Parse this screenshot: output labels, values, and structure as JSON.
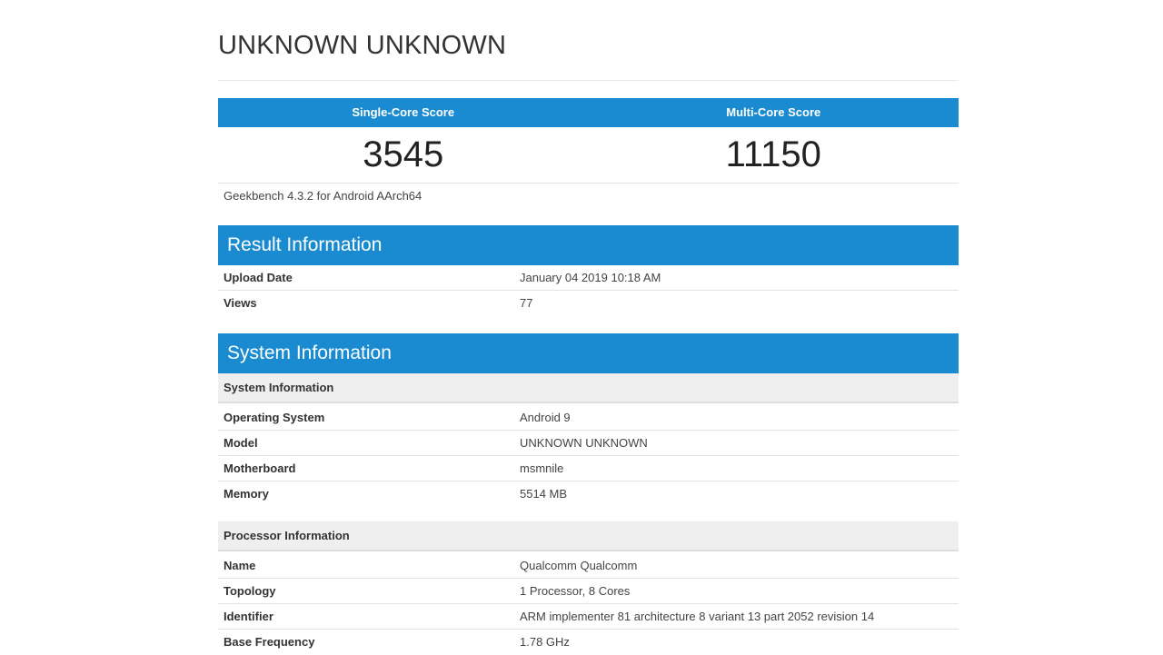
{
  "title": "UNKNOWN UNKNOWN",
  "scores": {
    "single_core_label": "Single-Core Score",
    "multi_core_label": "Multi-Core Score",
    "single_core_value": "3545",
    "multi_core_value": "11150"
  },
  "version": "Geekbench 4.3.2 for Android AArch64",
  "result_information": {
    "heading": "Result Information",
    "rows": [
      {
        "label": "Upload Date",
        "value": "January 04 2019 10:18 AM"
      },
      {
        "label": "Views",
        "value": "77"
      }
    ]
  },
  "system_information": {
    "heading": "System Information",
    "system_subheading": "System Information",
    "system_rows": [
      {
        "label": "Operating System",
        "value": "Android 9"
      },
      {
        "label": "Model",
        "value": "UNKNOWN UNKNOWN"
      },
      {
        "label": "Motherboard",
        "value": "msmnile"
      },
      {
        "label": "Memory",
        "value": "5514 MB"
      }
    ],
    "processor_subheading": "Processor Information",
    "processor_rows": [
      {
        "label": "Name",
        "value": "Qualcomm Qualcomm"
      },
      {
        "label": "Topology",
        "value": "1 Processor, 8 Cores"
      },
      {
        "label": "Identifier",
        "value": "ARM implementer 81 architecture 8 variant 13 part 2052 revision 14"
      },
      {
        "label": "Base Frequency",
        "value": "1.78 GHz"
      }
    ]
  },
  "colors": {
    "accent": "#1a8bd0",
    "subheader_bg": "#efefef"
  }
}
